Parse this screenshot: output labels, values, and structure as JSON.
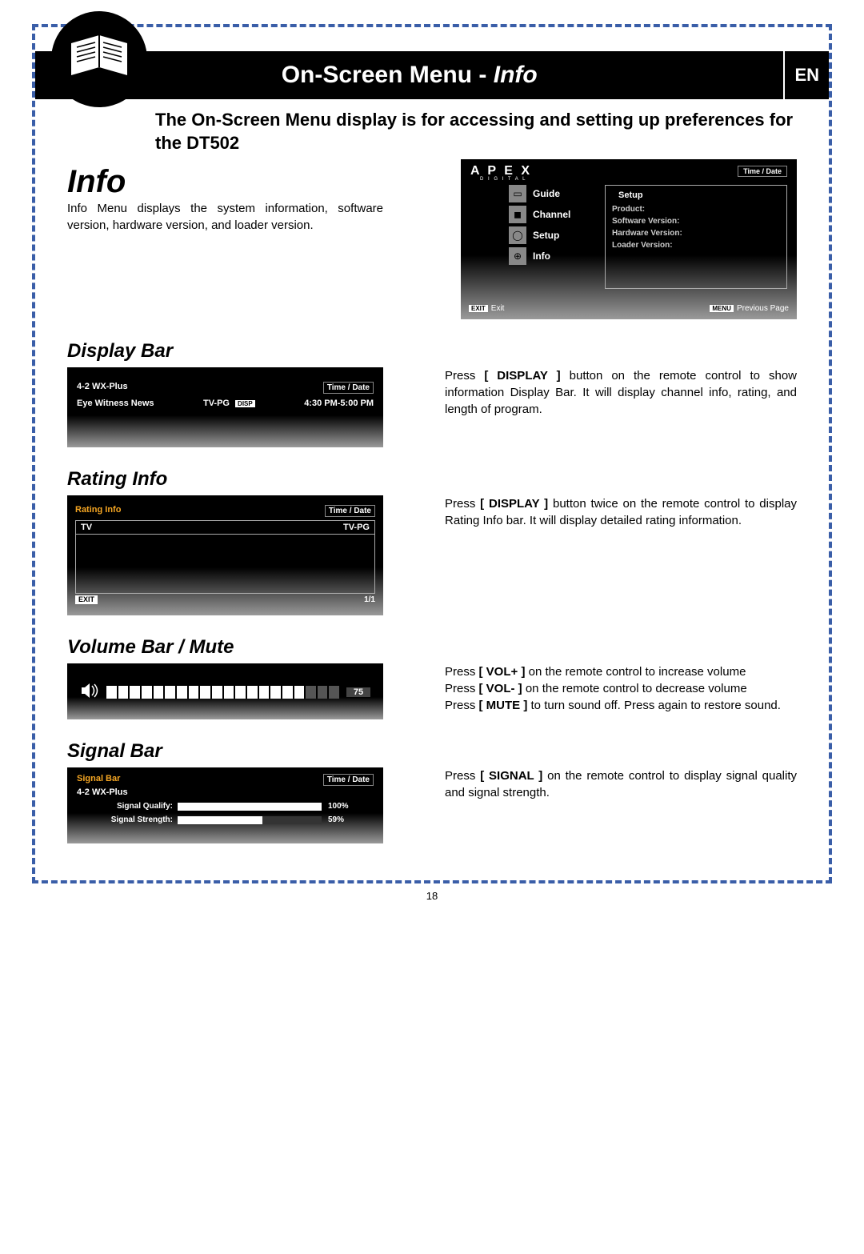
{
  "header": {
    "title_prefix": "On-Screen Menu - ",
    "title_italic": "Info",
    "lang": "EN",
    "subtitle": "The On-Screen Menu display is for accessing and setting up preferences for the DT502"
  },
  "info_section": {
    "heading": "Info",
    "text": "Info Menu displays the system information, software version, hardware version, and loader version."
  },
  "setup_screen": {
    "brand": "A P E X",
    "brand_sub": "D I G I T A L",
    "time_date": "Time / Date",
    "tab": "Setup",
    "menu": [
      {
        "icon": "tv",
        "label": "Guide"
      },
      {
        "icon": "square",
        "label": "Channel"
      },
      {
        "icon": "circle",
        "label": "Setup"
      },
      {
        "icon": "globe",
        "label": "Info"
      }
    ],
    "labels": [
      "Product:",
      "Software Version:",
      "Hardware Version:",
      "Loader Version:"
    ],
    "footer_left_key": "EXIT",
    "footer_left": "Exit",
    "footer_right_key": "MENU",
    "footer_right": "Previous Page"
  },
  "display_bar": {
    "heading": "Display Bar",
    "text_pre": "Press ",
    "text_btn": "[ DISPLAY ]",
    "text_post": " button on the remote control to show information Display Bar. It will display channel info, rating, and length of program.",
    "screen": {
      "channel": "4-2 WX-Plus",
      "time_date": "Time / Date",
      "program": "Eye Witness News",
      "rating": "TV-PG",
      "disp": "DISP",
      "timeslot": "4:30 PM-5:00 PM"
    }
  },
  "rating_info": {
    "heading": "Rating Info",
    "text_pre": "Press ",
    "text_btn": "[ DISPLAY ]",
    "text_post": " button twice on the remote control to display Rating Info bar. It will display detailed rating information.",
    "screen": {
      "title": "Rating Info",
      "time_date": "Time / Date",
      "left": "TV",
      "right": "TV-PG",
      "exit": "EXIT",
      "page": "1/1"
    }
  },
  "volume": {
    "heading": "Volume Bar / Mute",
    "line1_pre": "Press ",
    "line1_btn": "[ VOL+ ]",
    "line1_post": " on the remote control to increase volume",
    "line2_pre": "Press ",
    "line2_btn": "[ VOL- ]",
    "line2_post": " on the remote control to decrease volume",
    "line3_pre": "Press ",
    "line3_btn": "[ MUTE ]",
    "line3_post": " to turn sound off. Press again to restore sound.",
    "value": "75",
    "segments_on": 17,
    "segments_total": 20
  },
  "signal": {
    "heading": "Signal Bar",
    "text_pre": "Press ",
    "text_btn": "[ SIGNAL ]",
    "text_post": " on the remote control to display signal quality and signal strength.",
    "screen": {
      "title": "Signal Bar",
      "time_date": "Time / Date",
      "channel": "4-2 WX-Plus",
      "quality_label": "Signal Qualify:",
      "quality_pct": "100%",
      "strength_label": "Signal Strength:",
      "strength_pct": "59%"
    }
  },
  "page_number": "18"
}
